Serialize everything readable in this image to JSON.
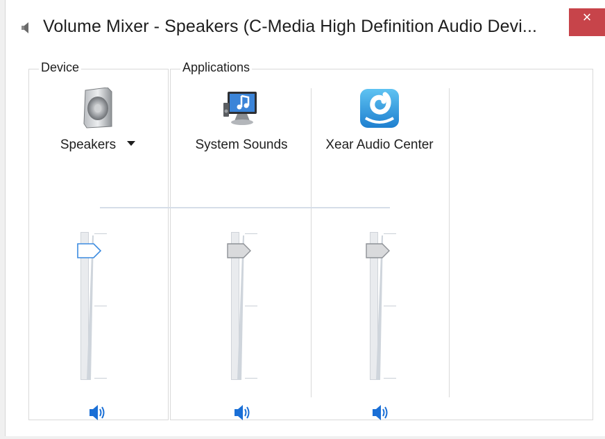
{
  "window": {
    "title": "Volume Mixer - Speakers (C-Media High Definition Audio Devi...",
    "close_glyph": "×",
    "title_icon": "speaker-icon"
  },
  "device_group": {
    "label": "Device",
    "device": {
      "name": "Speakers",
      "icon": "speaker-device-icon",
      "has_dropdown": true,
      "volume_level": 0.88,
      "mute_icon": "speaker-volume-icon"
    }
  },
  "applications_group": {
    "label": "Applications",
    "apps": [
      {
        "name": "System Sounds",
        "icon": "system-sounds-icon",
        "volume_level": 0.88,
        "mute_icon": "speaker-volume-icon"
      },
      {
        "name": "Xear Audio Center",
        "icon": "xear-audio-icon",
        "volume_level": 0.88,
        "mute_icon": "speaker-volume-icon"
      }
    ]
  },
  "colors": {
    "close_button": "#c7444a",
    "accent_blue": "#1a6fd6",
    "selected_thumb": "#3b8be0",
    "track": "#e9ebee"
  }
}
